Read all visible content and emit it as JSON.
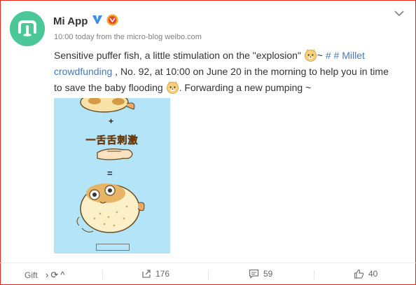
{
  "post": {
    "author": "Mi App",
    "meta": "10:00 today from the micro-blog weibo.com",
    "text_1": "Sensitive puffer fish, a little stimulation on the \"explosion\" ",
    "text_2": "~ ",
    "topic": "# # Millet crowdfunding",
    "text_3": " , No. 92, at 10:00 on June 20 in the morning to help you in time to save the baby flooding ",
    "text_4": ". Forwarding a new pumping ~",
    "emoji_name": "doge-emoji"
  },
  "media": {
    "slogan": "一舌舌刺激",
    "plus": "+",
    "equals": "="
  },
  "footer": {
    "gift_label": "Gift",
    "gift_nav": "›⟳^",
    "forward_count": "176",
    "comment_count": "59",
    "like_count": "40"
  },
  "colors": {
    "link": "#4a79b2",
    "avatar_bg": "#4cc79a",
    "border": "#e3251a",
    "verified": "#3b8ee8"
  }
}
